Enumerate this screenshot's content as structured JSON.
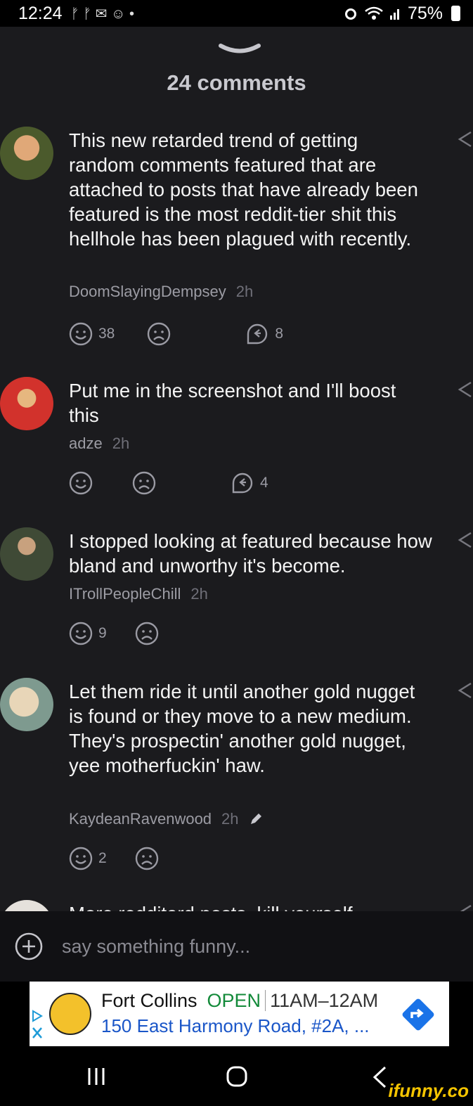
{
  "status": {
    "time": "12:24",
    "battery": "75%"
  },
  "sheet": {
    "title": "24 comments"
  },
  "comments": [
    {
      "text": "This new retarded trend of getting random comments featured that are attached to posts that have already been featured is the most reddit-tier shit this hellhole has been plagued with recently.",
      "author": "DoomSlayingDempsey",
      "time": "2h",
      "smiles": "38",
      "replies": "8"
    },
    {
      "text": "Put me in the screenshot and I'll boost this",
      "author": "adze",
      "time": "2h",
      "smiles": "",
      "replies": "4"
    },
    {
      "text": "I stopped looking at featured because how bland and unworthy it's become.",
      "author": "ITrollPeopleChill",
      "time": "2h",
      "smiles": "9",
      "replies": ""
    },
    {
      "text": "Let them ride it until another gold nugget is found or they move to a new medium. They's prospectin' another gold nugget, yee motherfuckin' haw.",
      "author": "KaydeanRavenwood",
      "time": "2h",
      "smiles": "2",
      "replies": ""
    },
    {
      "text": "More redditard posts, kill yourself"
    }
  ],
  "input": {
    "placeholder": "say something funny..."
  },
  "ad": {
    "name": "Fort Collins",
    "status": "OPEN",
    "hours": "11AM–12AM",
    "address": "150 East Harmony Road, #2A, ..."
  },
  "watermark": "ifunny.co"
}
